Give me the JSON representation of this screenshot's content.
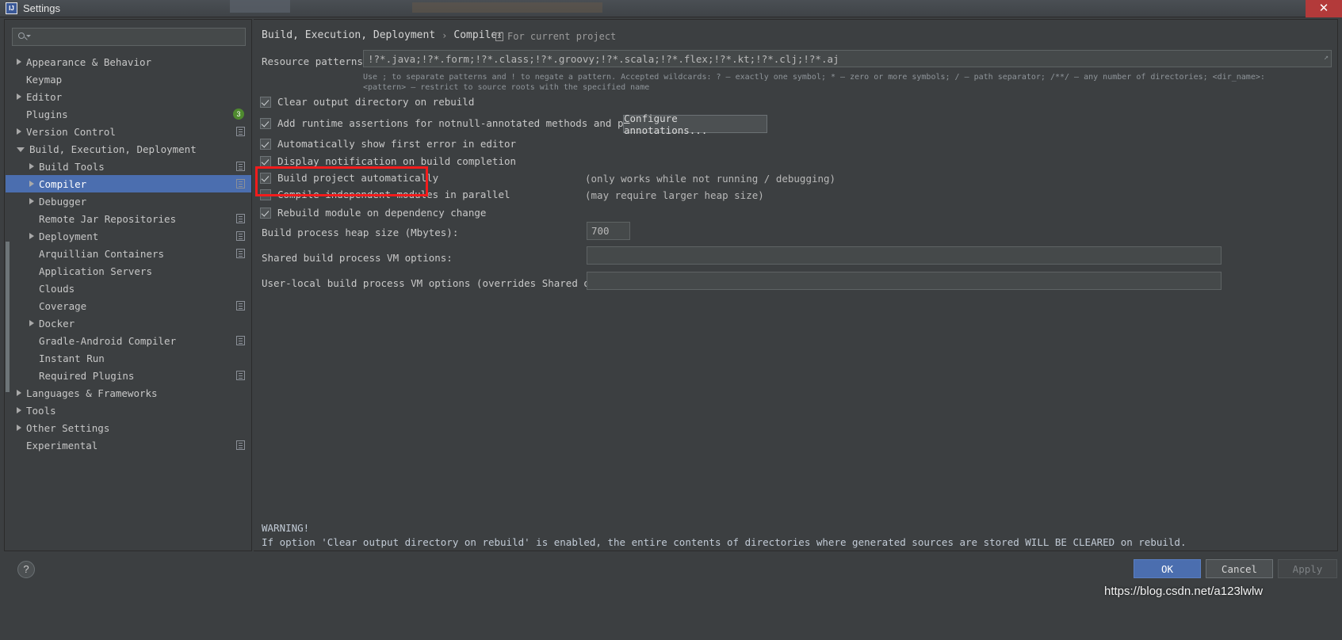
{
  "window": {
    "title": "Settings",
    "logo_text": "IJ",
    "close_label": "✕"
  },
  "search": {
    "value": "",
    "placeholder": "",
    "icon": "search-icon"
  },
  "sidebar": {
    "items": [
      {
        "label": "Appearance & Behavior",
        "indent": 0,
        "arrow": "right",
        "selected": false,
        "badge": "",
        "project_icon": false
      },
      {
        "label": "Keymap",
        "indent": 0,
        "arrow": "none",
        "selected": false,
        "badge": "",
        "project_icon": false
      },
      {
        "label": "Editor",
        "indent": 0,
        "arrow": "right",
        "selected": false,
        "badge": "",
        "project_icon": false
      },
      {
        "label": "Plugins",
        "indent": 0,
        "arrow": "none",
        "selected": false,
        "badge": "3",
        "project_icon": false
      },
      {
        "label": "Version Control",
        "indent": 0,
        "arrow": "right",
        "selected": false,
        "badge": "",
        "project_icon": true
      },
      {
        "label": "Build, Execution, Deployment",
        "indent": 0,
        "arrow": "down",
        "selected": false,
        "badge": "",
        "project_icon": false
      },
      {
        "label": "Build Tools",
        "indent": 1,
        "arrow": "right",
        "selected": false,
        "badge": "",
        "project_icon": true
      },
      {
        "label": "Compiler",
        "indent": 1,
        "arrow": "right",
        "selected": true,
        "badge": "",
        "project_icon": true
      },
      {
        "label": "Debugger",
        "indent": 1,
        "arrow": "right",
        "selected": false,
        "badge": "",
        "project_icon": false
      },
      {
        "label": "Remote Jar Repositories",
        "indent": 1,
        "arrow": "none",
        "selected": false,
        "badge": "",
        "project_icon": true
      },
      {
        "label": "Deployment",
        "indent": 1,
        "arrow": "right",
        "selected": false,
        "badge": "",
        "project_icon": true
      },
      {
        "label": "Arquillian Containers",
        "indent": 1,
        "arrow": "none",
        "selected": false,
        "badge": "",
        "project_icon": true
      },
      {
        "label": "Application Servers",
        "indent": 1,
        "arrow": "none",
        "selected": false,
        "badge": "",
        "project_icon": false
      },
      {
        "label": "Clouds",
        "indent": 1,
        "arrow": "none",
        "selected": false,
        "badge": "",
        "project_icon": false
      },
      {
        "label": "Coverage",
        "indent": 1,
        "arrow": "none",
        "selected": false,
        "badge": "",
        "project_icon": true
      },
      {
        "label": "Docker",
        "indent": 1,
        "arrow": "right",
        "selected": false,
        "badge": "",
        "project_icon": false
      },
      {
        "label": "Gradle-Android Compiler",
        "indent": 1,
        "arrow": "none",
        "selected": false,
        "badge": "",
        "project_icon": true
      },
      {
        "label": "Instant Run",
        "indent": 1,
        "arrow": "none",
        "selected": false,
        "badge": "",
        "project_icon": false
      },
      {
        "label": "Required Plugins",
        "indent": 1,
        "arrow": "none",
        "selected": false,
        "badge": "",
        "project_icon": true
      },
      {
        "label": "Languages & Frameworks",
        "indent": 0,
        "arrow": "right",
        "selected": false,
        "badge": "",
        "project_icon": false
      },
      {
        "label": "Tools",
        "indent": 0,
        "arrow": "right",
        "selected": false,
        "badge": "",
        "project_icon": false
      },
      {
        "label": "Other Settings",
        "indent": 0,
        "arrow": "right",
        "selected": false,
        "badge": "",
        "project_icon": false
      },
      {
        "label": "Experimental",
        "indent": 0,
        "arrow": "none",
        "selected": false,
        "badge": "",
        "project_icon": true
      }
    ]
  },
  "main": {
    "breadcrumb_root": "Build, Execution, Deployment",
    "breadcrumb_sep": "›",
    "breadcrumb_leaf": "Compiler",
    "for_current_project": "For current project",
    "resource_patterns_label": "Resource patterns:",
    "resource_patterns_value": "!?*.java;!?*.form;!?*.class;!?*.groovy;!?*.scala;!?*.flex;!?*.kt;!?*.clj;!?*.aj",
    "hint_line1": "Use ; to separate patterns and ! to negate a pattern. Accepted wildcards: ? — exactly one symbol; * — zero or more symbols; / — path separator; /**/ — any number of directories; <dir_name>:",
    "hint_line2": "<pattern> — restrict to source roots with the specified name",
    "checkboxes": [
      {
        "label": "Clear output directory on rebuild",
        "checked": true,
        "note": ""
      },
      {
        "label": "Add runtime assertions for notnull-annotated methods and parameters",
        "checked": true,
        "note": ""
      },
      {
        "label": "Automatically show first error in editor",
        "checked": true,
        "note": ""
      },
      {
        "label": "Display notification on build completion",
        "checked": true,
        "note": ""
      },
      {
        "label": "Build project automatically",
        "checked": true,
        "note": "(only works while not running / debugging)"
      },
      {
        "label": "Compile independent modules in parallel",
        "checked": false,
        "note": "(may require larger heap size)"
      },
      {
        "label": "Rebuild module on dependency change",
        "checked": true,
        "note": ""
      }
    ],
    "configure_annotations_label": "Configure annotations...",
    "heap_size_label": "Build process heap size (Mbytes):",
    "heap_size_value": "700",
    "shared_vm_label": "Shared build process VM options:",
    "shared_vm_value": "",
    "user_local_vm_label": "User-local build process VM options (overrides Shared options):",
    "user_local_vm_value": "",
    "warning_title": "WARNING!",
    "warning_text": "If option 'Clear output directory on rebuild' is enabled, the entire contents of directories where generated sources are stored WILL BE CLEARED on rebuild."
  },
  "footer": {
    "help_label": "?",
    "ok_label": "OK",
    "cancel_label": "Cancel",
    "apply_label": "Apply",
    "watermark": "https://blog.csdn.net/a123lwlw"
  },
  "colors": {
    "accent": "#4b6eaf",
    "highlight": "#f21c1c",
    "background": "#3c3f41",
    "field": "#45494a",
    "close": "#b33a3a",
    "badge": "#4f8a2f"
  }
}
